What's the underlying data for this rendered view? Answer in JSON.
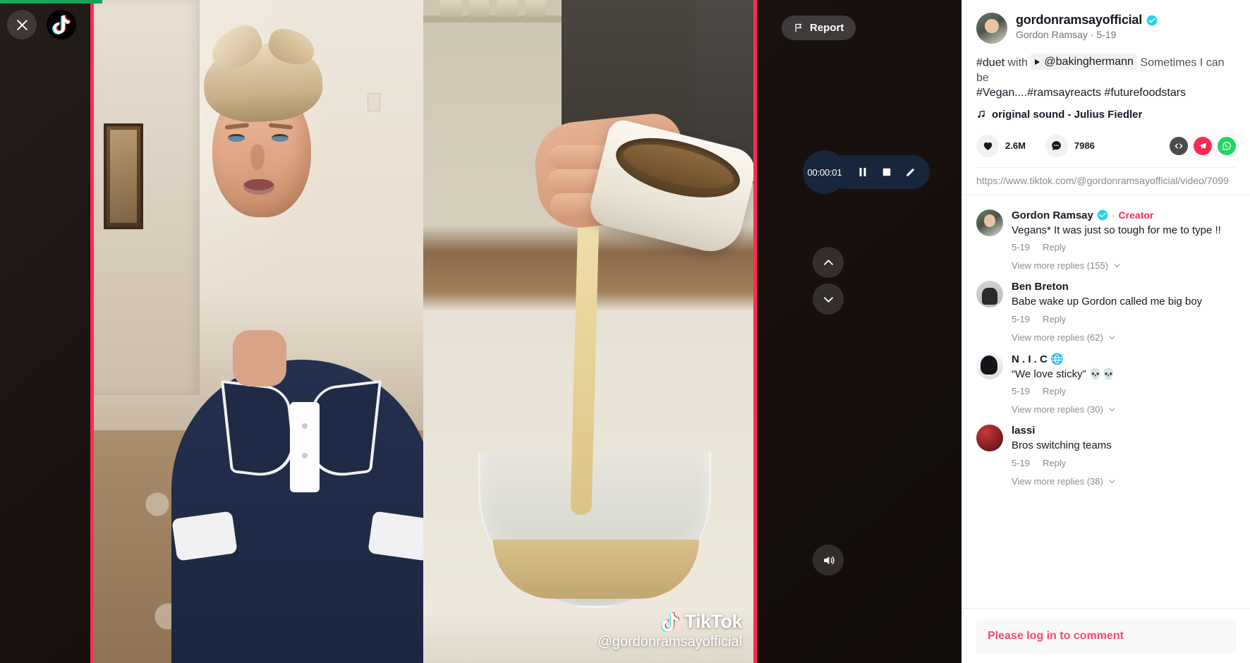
{
  "window": {
    "close_label": "Close",
    "logo_label": "TikTok"
  },
  "video": {
    "report_label": "Report",
    "watermark_brand": "TikTok",
    "watermark_user": "@gordonramsayofficial",
    "nav_up_label": "Previous video",
    "nav_down_label": "Next video",
    "volume_label": "Volume"
  },
  "recorder": {
    "time": "00:00:01",
    "pause_label": "Pause",
    "stop_label": "Stop",
    "edit_label": "Annotate"
  },
  "author": {
    "username": "gordonramsayofficial",
    "nickname": "Gordon Ramsay",
    "date": "5-19",
    "separator": "·"
  },
  "caption": {
    "tag_duet": "#duet",
    "with_word": "with",
    "mention": "@bakinghermann",
    "rest": "Sometimes I can be",
    "line2": "#Vegan....#ramsayreacts #futurefoodstars"
  },
  "music": {
    "title": "original sound - Julius Fiedler"
  },
  "stats": {
    "likes": "2.6M",
    "comments": "7986"
  },
  "share": {
    "embed_label": "Embed",
    "telegram_label": "Share to Telegram",
    "whatsapp_label": "Share to WhatsApp"
  },
  "link": {
    "url": "https://www.tiktok.com/@gordonramsayofficial/video/7099"
  },
  "comments": [
    {
      "name": "Gordon Ramsay",
      "verified": true,
      "badge": "Creator",
      "dot": "·",
      "text": "Vegans* It was just so tough for me to type !!",
      "date": "5-19",
      "reply": "Reply",
      "more": "View more replies (155)",
      "avatar_class": "gordon"
    },
    {
      "name": "Ben Breton",
      "verified": false,
      "badge": "",
      "dot": "",
      "text": "Babe wake up Gordon called me big boy",
      "date": "5-19",
      "reply": "Reply",
      "more": "View more replies (62)",
      "avatar_class": "ben"
    },
    {
      "name": "N . I . C 🌐",
      "verified": false,
      "badge": "",
      "dot": "",
      "text": "“We love sticky” 💀💀",
      "date": "5-19",
      "reply": "Reply",
      "more": "View more replies (30)",
      "avatar_class": "nic"
    },
    {
      "name": "lassi",
      "verified": false,
      "badge": "",
      "dot": "",
      "text": "Bros switching teams",
      "date": "5-19",
      "reply": "Reply",
      "more": "View more replies (38)",
      "avatar_class": "lassi"
    }
  ],
  "login": {
    "message": "Please log in to comment"
  },
  "colors": {
    "accent_red": "#fe2c55",
    "verified_blue": "#20d5ec",
    "whatsapp_green": "#25d366",
    "recorder_navy": "#17263c"
  }
}
